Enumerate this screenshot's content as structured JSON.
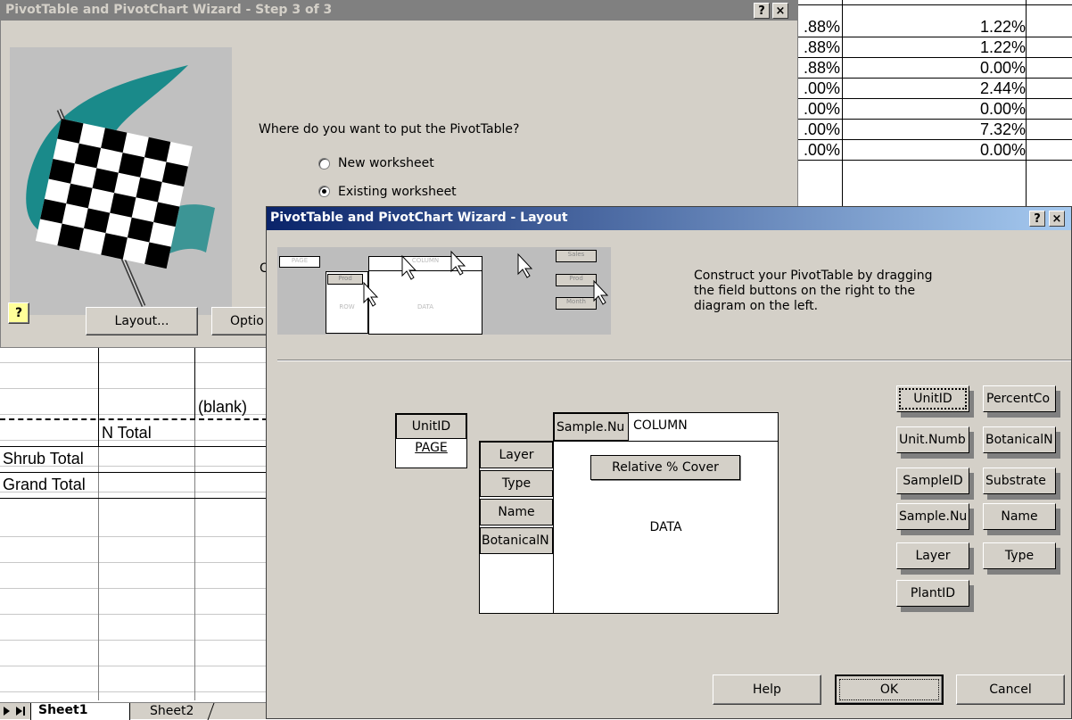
{
  "spreadsheet": {
    "right_rows": [
      {
        "a": ".88%",
        "b": "1.22%"
      },
      {
        "a": ".88%",
        "b": "1.22%"
      },
      {
        "a": ".88%",
        "b": "0.00%"
      },
      {
        "a": ".00%",
        "b": "2.44%"
      },
      {
        "a": ".00%",
        "b": "0.00%"
      },
      {
        "a": ".00%",
        "b": "7.32%"
      },
      {
        "a": ".00%",
        "b": "0.00%"
      }
    ],
    "blank_label": "(blank)",
    "n_total": "N Total",
    "shrub_total": "Shrub Total",
    "grand_total": "Grand Total",
    "tabs": [
      "Sheet1",
      "Sheet2"
    ]
  },
  "step3": {
    "title": "PivotTable and PivotChart Wizard - Step 3 of 3",
    "question": "Where do you want to put the PivotTable?",
    "options": [
      {
        "label": "New worksheet",
        "selected": false
      },
      {
        "label": "Existing worksheet",
        "selected": true
      }
    ],
    "layout_button": "Layout...",
    "options_button": "Optio",
    "help_glyph": "?",
    "close_glyph": "×",
    "partial_label": "C"
  },
  "layout": {
    "title": "PivotTable and PivotChart Wizard - Layout",
    "help_glyph": "?",
    "close_glyph": "×",
    "instructions": [
      "Construct your PivotTable by dragging",
      "the field buttons on the right to the",
      "diagram on the left."
    ],
    "preview": {
      "page": "PAGE",
      "row": "ROW",
      "data": "DATA",
      "column": "COLUMN",
      "prod": "Prod",
      "sales": "Sales",
      "month": "Month"
    },
    "page_area": {
      "field": "UnitID",
      "label": "PAGE"
    },
    "column_area": {
      "field": "Sample.Nu",
      "label": "COLUMN"
    },
    "row_fields": [
      "Layer",
      "Type",
      "Name",
      "BotanicalN"
    ],
    "data_field": "Relative % Cover",
    "data_label": "DATA",
    "field_buttons": [
      "UnitID",
      "PercentCo",
      "Unit.Numb",
      "BotanicalN",
      "SampleID",
      "Substrate",
      "Sample.Nu",
      "Name",
      "Layer",
      "Type",
      "PlantID"
    ],
    "buttons": {
      "help": "Help",
      "ok": "OK",
      "cancel": "Cancel"
    }
  },
  "colors": {
    "title_active": "#0a246a",
    "title_active_end": "#a6caf0",
    "title_inactive": "#808080",
    "dialog_face": "#d4d0c8",
    "flag_teal": "#1a8a8a"
  }
}
